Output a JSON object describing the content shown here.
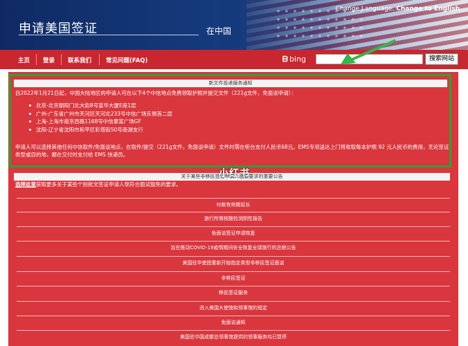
{
  "header": {
    "title": "申请美国签证",
    "location": "在中国",
    "language_prefix": "Change Language:",
    "language_option": "Change to English"
  },
  "nav": {
    "items": [
      "主页",
      "登录",
      "联系我们",
      "常见问题(FAQ)"
    ],
    "search_logo": "bing",
    "search_value": "",
    "search_button": "搜索网站"
  },
  "notice": {
    "title": "新文件投递服务通知",
    "intro": "自2022年1月21日起，中国大陆地区的申请人可在以下4个中信地点免费领取护照并提交文件（221g文件，免面谈申请）：",
    "locations": [
      "北京-北京朝阳门北大街8号富华大厦E座1层",
      "广州-广东省广州市天河区天河北233号中信广场东侧首二层",
      "上海-上海市南京西路1168号中信泰富广场GF",
      "沈阳-辽宁省沈阳市和平区彩塔街50号南湖支行"
    ],
    "body": "申请人可以选择其他任何中信取件/免面谈地点，在取件/提交（221g文件，免面谈申请）文件时需在柜台支付人民币68元。EMS专项送达上门将收取每本护照 92 元人民币的费用，无论签证类型或目的地，都在交付时支付给 EMS 快递员。"
  },
  "announcement": {
    "title": "关于某些非移民签证申请人面谈要求的重要公告",
    "watermark": "小红书",
    "intro_link": "选择这里",
    "intro_rest": "获取更多关于某些个别批文签证申请人现符合面试豁免的要求。"
  },
  "links": [
    "付款有效期延长",
    "旅行所需核酸检测阴性报告",
    "免面谈签证申请恢复",
    "旨在推动COVID-19疫情期间安全恢复全球旅行的总统公告",
    "美国驻华使团重新开始指定类型非移民签证面谈",
    "非移民签证",
    "移民签证服务",
    "进入美国大使馆和领事馆的规定",
    "免面谈通知",
    "美国驻中国成都总领事馆提供的领事服务均已暂停"
  ],
  "colors": {
    "header_blue": "#153a7c",
    "nav_red": "#c8272f",
    "content_red": "#d9363e",
    "highlight_green": "#2fa136"
  }
}
